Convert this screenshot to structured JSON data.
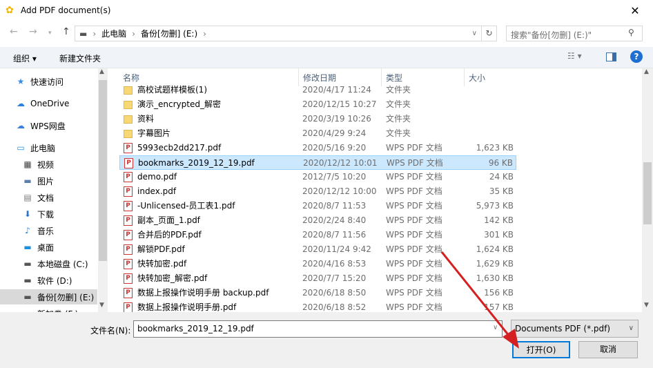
{
  "window": {
    "title": "Add PDF document(s)",
    "close": "✕"
  },
  "address": {
    "back": "←",
    "forward": "→",
    "up": "↑",
    "crumbs": [
      "此电脑",
      "备份[勿删] (E:)"
    ],
    "search_placeholder": "搜索\"备份[勿删] (E:)\""
  },
  "toolbar": {
    "organize": "组织 ▾",
    "new_folder": "新建文件夹"
  },
  "nav": [
    {
      "label": "快速访问",
      "icon": "★",
      "color": "#3a8ee6"
    },
    {
      "label": "OneDrive",
      "icon": "☁",
      "color": "#2f7ed8"
    },
    {
      "label": "WPS网盘",
      "icon": "☁",
      "color": "#3c7fd8"
    },
    {
      "label": "此电脑",
      "icon": "▭",
      "color": "#1e90d9"
    },
    {
      "label": "视频",
      "icon": "▦",
      "color": "#444"
    },
    {
      "label": "图片",
      "icon": "▬",
      "color": "#5a7fa8"
    },
    {
      "label": "文档",
      "icon": "▤",
      "color": "#777"
    },
    {
      "label": "下载",
      "icon": "⬇",
      "color": "#2b78d4"
    },
    {
      "label": "音乐",
      "icon": "♪",
      "color": "#1e88e5"
    },
    {
      "label": "桌面",
      "icon": "▬",
      "color": "#1e90d9"
    },
    {
      "label": "本地磁盘 (C:)",
      "icon": "▬",
      "color": "#555"
    },
    {
      "label": "软件 (D:)",
      "icon": "▬",
      "color": "#555"
    },
    {
      "label": "备份[勿删] (E:)",
      "icon": "▬",
      "color": "#555"
    },
    {
      "label": "新加卷 (F:)",
      "icon": "▬",
      "color": "#555"
    }
  ],
  "columns": [
    "名称",
    "修改日期",
    "类型",
    "大小"
  ],
  "files": [
    {
      "name": "高校试题样模板(1)",
      "date": "2020/4/17 11:24",
      "type": "文件夹",
      "size": "",
      "kind": "folder"
    },
    {
      "name": "演示_encrypted_解密",
      "date": "2020/12/15 10:27",
      "type": "文件夹",
      "size": "",
      "kind": "folder"
    },
    {
      "name": "资料",
      "date": "2020/3/19 10:26",
      "type": "文件夹",
      "size": "",
      "kind": "folder"
    },
    {
      "name": "字幕图片",
      "date": "2020/4/29 9:24",
      "type": "文件夹",
      "size": "",
      "kind": "folder"
    },
    {
      "name": "5993ecb2dd217.pdf",
      "date": "2020/5/16 9:20",
      "type": "WPS PDF 文档",
      "size": "1,623 KB",
      "kind": "pdf"
    },
    {
      "name": "bookmarks_2019_12_19.pdf",
      "date": "2020/12/12 10:01",
      "type": "WPS PDF 文档",
      "size": "96 KB",
      "kind": "pdf",
      "selected": true
    },
    {
      "name": "demo.pdf",
      "date": "2012/7/5 10:20",
      "type": "WPS PDF 文档",
      "size": "24 KB",
      "kind": "pdf"
    },
    {
      "name": "index.pdf",
      "date": "2020/12/12 10:00",
      "type": "WPS PDF 文档",
      "size": "35 KB",
      "kind": "pdf"
    },
    {
      "name": "-Unlicensed-员工表1.pdf",
      "date": "2020/8/7 11:53",
      "type": "WPS PDF 文档",
      "size": "5,973 KB",
      "kind": "pdf"
    },
    {
      "name": "副本_页面_1.pdf",
      "date": "2020/2/24 8:40",
      "type": "WPS PDF 文档",
      "size": "142 KB",
      "kind": "pdf"
    },
    {
      "name": "合并后的PDF.pdf",
      "date": "2020/8/7 11:56",
      "type": "WPS PDF 文档",
      "size": "301 KB",
      "kind": "pdf"
    },
    {
      "name": "解锁PDF.pdf",
      "date": "2020/11/24 9:42",
      "type": "WPS PDF 文档",
      "size": "1,624 KB",
      "kind": "pdf"
    },
    {
      "name": "快转加密.pdf",
      "date": "2020/4/16 8:53",
      "type": "WPS PDF 文档",
      "size": "1,629 KB",
      "kind": "pdf"
    },
    {
      "name": "快转加密_解密.pdf",
      "date": "2020/7/7 15:20",
      "type": "WPS PDF 文档",
      "size": "1,630 KB",
      "kind": "pdf"
    },
    {
      "name": "数据上报操作说明手册 backup.pdf",
      "date": "2020/6/18 8:50",
      "type": "WPS PDF 文档",
      "size": "156 KB",
      "kind": "pdf"
    },
    {
      "name": "数据上报操作说明手册.pdf",
      "date": "2020/6/18 8:52",
      "type": "WPS PDF 文档",
      "size": "157 KB",
      "kind": "pdf"
    }
  ],
  "footer": {
    "filename_label": "文件名(N):",
    "filename_value": "bookmarks_2019_12_19.pdf",
    "filter": "Documents PDF (*.pdf)",
    "open": "打开(O)",
    "cancel": "取消"
  },
  "colors": {
    "selected_bg": "#cce8ff",
    "accent": "#0078d7",
    "arrow": "#d42020"
  }
}
